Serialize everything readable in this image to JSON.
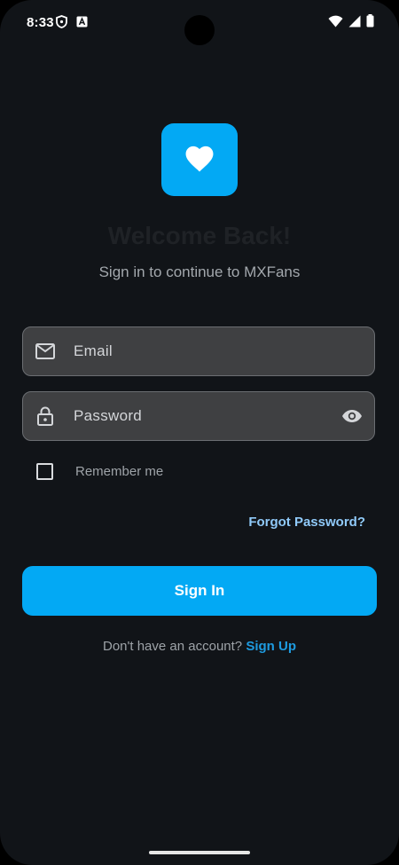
{
  "status_bar": {
    "time": "8:33",
    "icons": [
      "shield-icon",
      "app-notification-icon",
      "wifi-icon",
      "signal-icon",
      "battery-icon"
    ]
  },
  "brand": {
    "logo_icon": "heart-icon",
    "accent_color": "#03a9f4"
  },
  "header": {
    "title": "Welcome Back!",
    "subtitle": "Sign in to continue to MXFans"
  },
  "form": {
    "email": {
      "placeholder": "Email",
      "value": "",
      "icon": "mail-icon"
    },
    "password": {
      "placeholder": "Password",
      "value": "",
      "icon": "lock-icon",
      "toggle_icon": "eye-icon"
    },
    "remember_me": {
      "label": "Remember me",
      "checked": false
    },
    "forgot_password": "Forgot Password?",
    "submit_label": "Sign In"
  },
  "footer": {
    "prompt": "Don't have an account?",
    "signup_label": "Sign Up"
  }
}
